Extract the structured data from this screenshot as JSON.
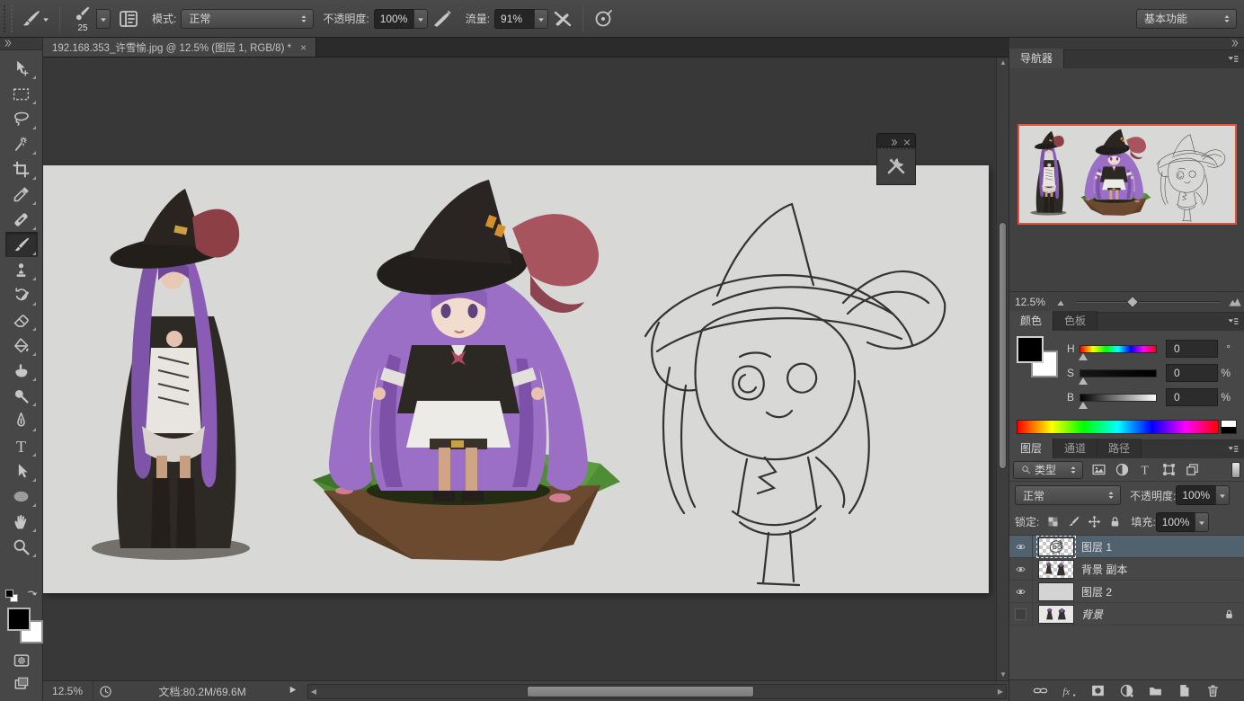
{
  "options_bar": {
    "brush_size": "25",
    "mode_label": "模式:",
    "mode_value": "正常",
    "opacity_label": "不透明度:",
    "opacity_value": "100%",
    "flow_label": "流量:",
    "flow_value": "91%",
    "workspace_value": "基本功能"
  },
  "document_tab": {
    "title": "192.168.353_许雪愉.jpg @ 12.5% (图层 1, RGB/8) *",
    "close_glyph": "×"
  },
  "status_bar": {
    "zoom": "12.5%",
    "doc_info": "文档:80.2M/69.6M"
  },
  "navigator": {
    "tab": "导航器",
    "zoom": "12.5%"
  },
  "color_panel": {
    "tabs": [
      "颜色",
      "色板"
    ],
    "sliders": [
      {
        "label": "H",
        "value": "0",
        "unit": "°"
      },
      {
        "label": "S",
        "value": "0",
        "unit": "%"
      },
      {
        "label": "B",
        "value": "0",
        "unit": "%"
      }
    ]
  },
  "layers_panel": {
    "tabs": [
      "图层",
      "通道",
      "路径"
    ],
    "filter_label": "类型",
    "blend_mode": "正常",
    "opacity_label": "不透明度:",
    "opacity_value": "100%",
    "lock_label": "锁定:",
    "fill_label": "填充:",
    "fill_value": "100%",
    "layers": [
      {
        "name": "图层 1",
        "visible": true,
        "selected": true,
        "thumb": "sketch",
        "locked": false,
        "italic": false
      },
      {
        "name": "背景 副本",
        "visible": true,
        "selected": false,
        "thumb": "figures",
        "locked": false,
        "italic": false
      },
      {
        "name": "图层 2",
        "visible": true,
        "selected": false,
        "thumb": "gray",
        "locked": false,
        "italic": false
      },
      {
        "name": "背景",
        "visible": false,
        "selected": false,
        "thumb": "white",
        "locked": true,
        "italic": true
      }
    ]
  },
  "tools": [
    {
      "id": "move-tool"
    },
    {
      "id": "rectangular-marquee-tool"
    },
    {
      "id": "lasso-tool"
    },
    {
      "id": "magic-wand-tool"
    },
    {
      "id": "crop-tool"
    },
    {
      "id": "eyedropper-tool"
    },
    {
      "id": "spot-healing-brush-tool"
    },
    {
      "id": "brush-tool",
      "selected": true
    },
    {
      "id": "clone-stamp-tool"
    },
    {
      "id": "history-brush-tool"
    },
    {
      "id": "eraser-tool"
    },
    {
      "id": "paint-bucket-tool"
    },
    {
      "id": "smudge-tool"
    },
    {
      "id": "dodge-tool"
    },
    {
      "id": "pen-tool"
    },
    {
      "id": "type-tool"
    },
    {
      "id": "path-selection-tool"
    },
    {
      "id": "ellipse-tool"
    },
    {
      "id": "hand-tool"
    },
    {
      "id": "zoom-tool"
    }
  ],
  "colors": {
    "selection_blue": "#52616e",
    "navigator_border": "#e0503a",
    "canvas_background": "#d8d8d6",
    "pasteboard": "#383838",
    "foreground": "#000000",
    "background": "#ffffff"
  }
}
